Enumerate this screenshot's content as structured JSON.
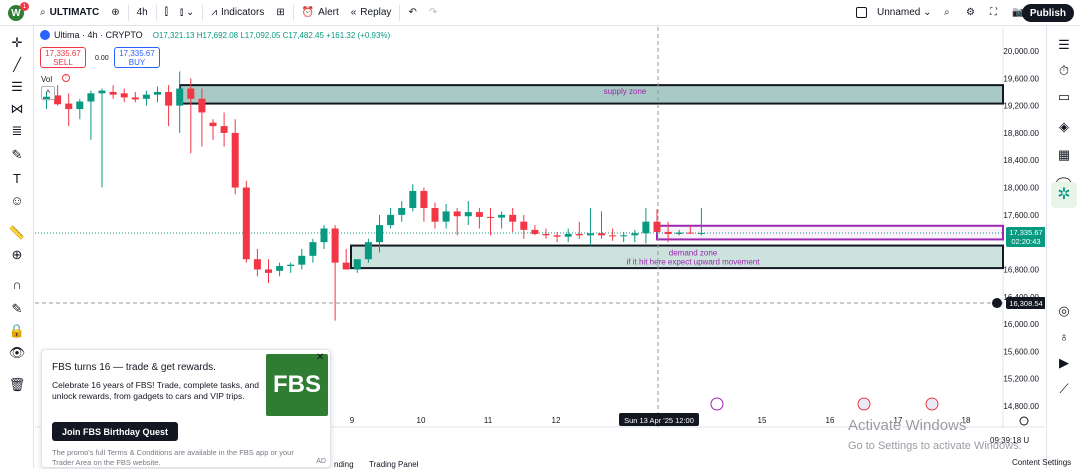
{
  "topbar": {
    "avatar_letter": "W",
    "avatar_badge": "1",
    "symbol": "ULTIMATC",
    "interval": "4h",
    "indicators": "Indicators",
    "alert": "Alert",
    "replay": "Replay",
    "layout_name": "Unnamed",
    "publish": "Publish"
  },
  "legend": {
    "title": "Ultima · 4h · CRYPTO",
    "ohlc": "O17,321.13 H17,692.08 L17,092.05 C17,482.45 +161.32 (+0.93%)",
    "sell_price": "17,335.67",
    "sell_label": "SELL",
    "spread": "0.00",
    "buy_price": "17,335.67",
    "buy_label": "BUY",
    "vol": "Vol"
  },
  "zones": {
    "supply": "supply zone",
    "demand": "demand zone",
    "demand_note": "if it hit here expect upward movement"
  },
  "price_axis": {
    "ticks": [
      "20,000.00",
      "19,600.00",
      "19,200.00",
      "18,800.00",
      "18,400.00",
      "18,000.00",
      "17,600.00",
      "16,800.00",
      "16,400.00",
      "16,000.00",
      "15,600.00",
      "15,200.00",
      "14,800.00"
    ],
    "current_price": "17,335.67",
    "countdown": "02:20:43",
    "crosshair_price": "16,308.54"
  },
  "time_axis": {
    "ticks": [
      "9",
      "10",
      "11",
      "12",
      "15",
      "16",
      "17",
      "18"
    ],
    "crosshair_time": "Sun 13 Apr '25   12:00",
    "clock": "09:39:18 U"
  },
  "popup": {
    "title": "FBS turns 16 — trade & get rewards.",
    "body": "Celebrate 16 years of FBS! Trade, complete tasks, and unlock rewards, from gadgets to cars and VIP trips.",
    "cta": "Join FBS Birthday Quest",
    "footer": "The promo's full Terms & Conditions are available in the FBS app or your Trader Area on the FBS website.",
    "logo": "FBS",
    "close": "✕",
    "ad": "AD"
  },
  "bottom": {
    "tab1": "nding",
    "tab2": "Trading Panel",
    "content_settings": "Content Settings"
  },
  "watermark": {
    "line1": "Activate Windows",
    "line2": "Go to Settings to activate Windows."
  },
  "colors": {
    "up": "#089981",
    "down": "#f23645",
    "supply": "#a9c9c4",
    "demand_fill": "#cbe2dd",
    "demand_line": "#9c27b0",
    "current": "#089981"
  }
}
